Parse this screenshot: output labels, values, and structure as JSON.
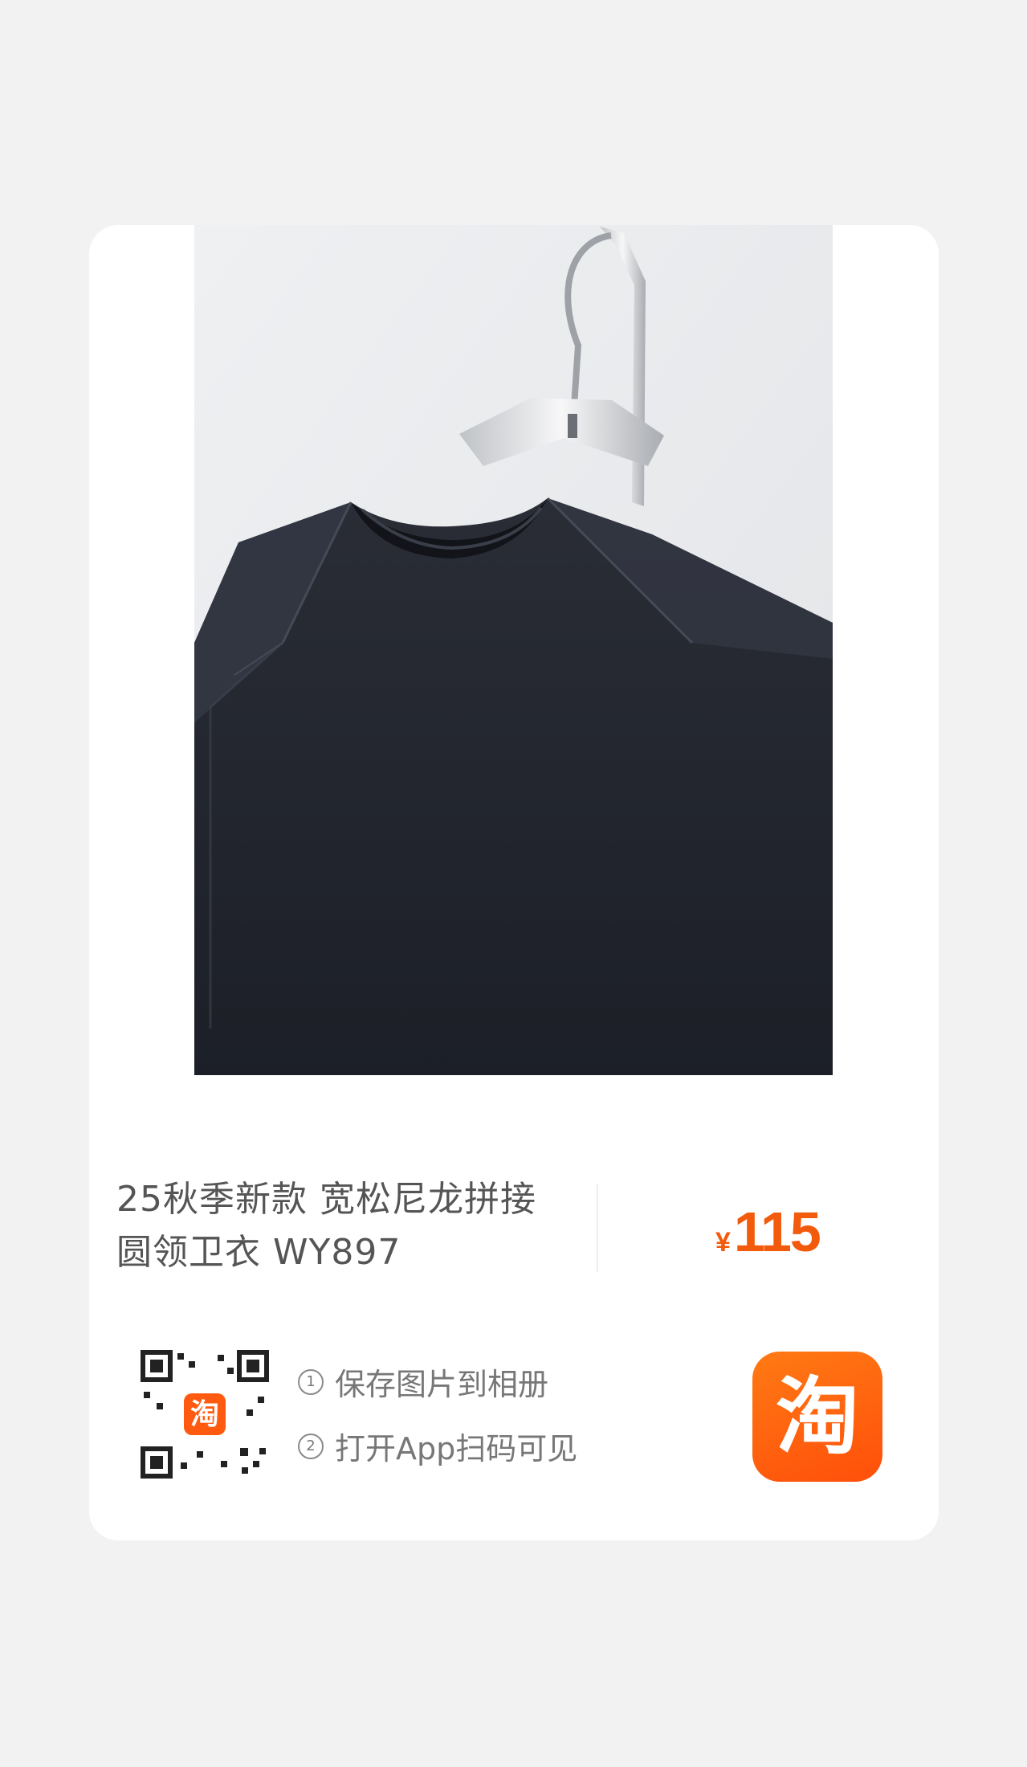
{
  "product": {
    "title_line1": "25秋季新款 宽松尼龙拼接",
    "title_line2": "圆领卫衣 WY897",
    "price_currency": "¥",
    "price_value": "115"
  },
  "qr": {
    "steps": [
      {
        "num": "1",
        "text": "保存图片到相册"
      },
      {
        "num": "2",
        "text": "打开App扫码可见"
      }
    ]
  },
  "app_icon": {
    "glyph": "淘",
    "icon": "taobao-logo-icon"
  },
  "colors": {
    "accent": "#f25a0c",
    "text": "#555555",
    "background": "#f2f2f2",
    "card": "#ffffff"
  }
}
